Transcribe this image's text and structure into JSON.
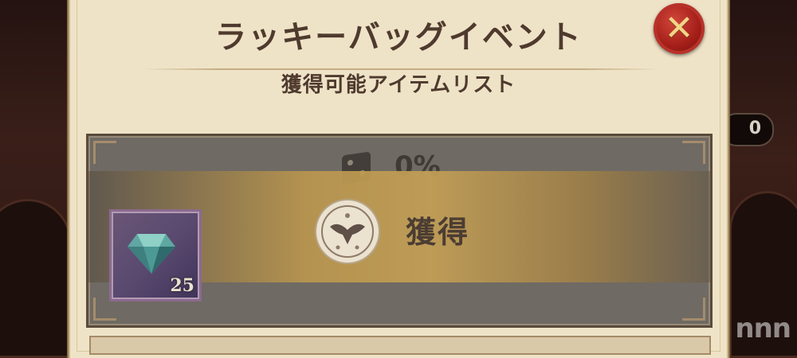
{
  "dialog": {
    "title": "ラッキーバッグイベント",
    "subtitle": "獲得可能アイテムリスト",
    "close_label": "✕"
  },
  "item_group": {
    "rate": "0%",
    "status": "獲得",
    "items": [
      {
        "icon": "gem-icon",
        "count": "25"
      }
    ]
  },
  "hud": {
    "counter_value": "0"
  },
  "watermark": "nnn",
  "colors": {
    "panel": "#efe3c7",
    "title_text": "#4f3a2e",
    "close_button": "#a51f19",
    "banner_gold": "#c4a056",
    "item_frame": "#8b6a8e"
  }
}
